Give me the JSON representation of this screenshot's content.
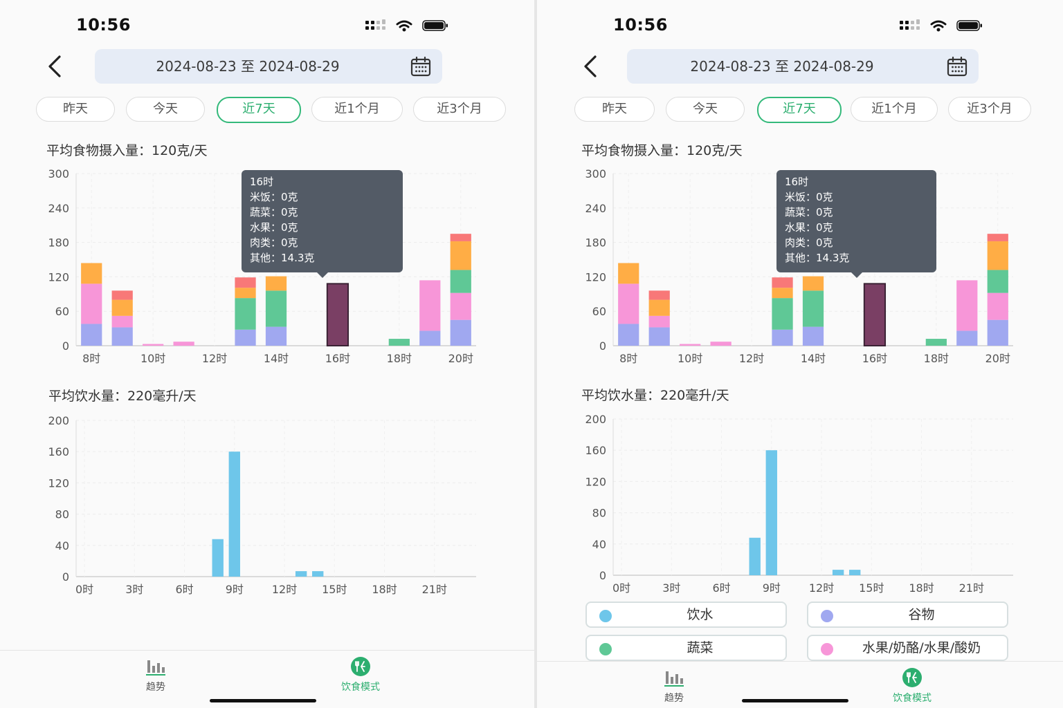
{
  "status": {
    "time": "10:56"
  },
  "header": {
    "date_range": "2024-08-23 至 2024-08-29"
  },
  "tabs": [
    {
      "label": "昨天",
      "active": false
    },
    {
      "label": "今天",
      "active": false
    },
    {
      "label": "近7天",
      "active": true
    },
    {
      "label": "近1个月",
      "active": false
    },
    {
      "label": "近3个月",
      "active": false
    }
  ],
  "food_section": {
    "title": "平均食物摄入量：120克/天"
  },
  "water_section": {
    "title": "平均饮水量：220毫升/天",
    "title_right": "平均饮水量：220毫升/天"
  },
  "tooltip": {
    "title": "16时",
    "rows": [
      "米饭：0克",
      "蔬菜：0克",
      "水果：0克",
      "肉类：0克",
      "其他：14.3克"
    ]
  },
  "legend": [
    {
      "label": "饮水",
      "color": "#6ec6ea"
    },
    {
      "label": "谷物",
      "color": "#a0a8f0"
    },
    {
      "label": "蔬菜",
      "color": "#5fc896"
    },
    {
      "label": "水果/奶酪/水果/酸奶",
      "color": "#f796d8"
    }
  ],
  "nav": [
    {
      "label": "趋势",
      "icon": "bar-chart-icon",
      "active": false
    },
    {
      "label": "饮食模式",
      "icon": "utensils-icon",
      "active": true
    }
  ],
  "colors": {
    "accent": "#2cae6f",
    "grain": "#a0a8f0",
    "fruit": "#f796d8",
    "veg": "#5fc896",
    "orange": "#ffad45",
    "red": "#f87878",
    "dark": "#7a3f64",
    "water": "#6ec6ea"
  },
  "chart_data": [
    {
      "type": "bar",
      "stacked": true,
      "title": "平均食物摄入量：120克/天",
      "categories": [
        "8时",
        "9时",
        "10时",
        "11时",
        "12时",
        "13时",
        "14时",
        "15时",
        "16时",
        "17时",
        "18时",
        "19时",
        "20时"
      ],
      "x_tick_labels": [
        "8时",
        "10时",
        "12时",
        "14时",
        "16时",
        "18时",
        "20时"
      ],
      "ylim": [
        0,
        300
      ],
      "y_ticks": [
        0,
        60,
        120,
        180,
        240,
        300
      ],
      "grid": true,
      "series": [
        {
          "color": "#a0a8f0",
          "values": [
            38,
            32,
            0,
            0,
            0,
            28,
            33,
            0,
            0,
            0,
            0,
            26,
            45
          ]
        },
        {
          "color": "#f796d8",
          "values": [
            70,
            20,
            3,
            7,
            0,
            0,
            0,
            0,
            0,
            0,
            0,
            88,
            47
          ]
        },
        {
          "color": "#5fc896",
          "values": [
            0,
            0,
            0,
            0,
            0,
            55,
            63,
            0,
            0,
            0,
            12,
            0,
            40
          ]
        },
        {
          "color": "#ffad45",
          "values": [
            36,
            28,
            0,
            0,
            0,
            18,
            25,
            0,
            0,
            0,
            0,
            0,
            50
          ]
        },
        {
          "color": "#f87878",
          "values": [
            0,
            16,
            0,
            0,
            0,
            18,
            0,
            0,
            0,
            0,
            0,
            0,
            13
          ]
        },
        {
          "color": "#7a3f64",
          "values": [
            0,
            0,
            0,
            0,
            0,
            0,
            0,
            0,
            108,
            0,
            0,
            0,
            0
          ]
        }
      ]
    },
    {
      "type": "bar",
      "title": "平均饮水量：220毫升/天",
      "categories": [
        "0时",
        "1时",
        "2时",
        "3时",
        "4时",
        "5时",
        "6时",
        "7时",
        "8时",
        "9时",
        "10时",
        "11时",
        "12时",
        "13时",
        "14时",
        "15时",
        "16时",
        "17时",
        "18时",
        "19时",
        "20时",
        "21时",
        "22时",
        "23时"
      ],
      "x_tick_labels": [
        "0时",
        "3时",
        "6时",
        "9时",
        "12时",
        "15时",
        "18时",
        "21时"
      ],
      "ylim": [
        0,
        200
      ],
      "y_ticks": [
        0,
        40,
        80,
        120,
        160,
        200
      ],
      "grid": true,
      "series": [
        {
          "name": "饮水",
          "color": "#6ec6ea",
          "values": [
            0,
            0,
            0,
            0,
            0,
            0,
            0,
            0,
            48,
            160,
            0,
            0,
            0,
            7,
            7,
            0,
            0,
            0,
            0,
            0,
            0,
            0,
            0,
            0
          ]
        }
      ]
    }
  ]
}
